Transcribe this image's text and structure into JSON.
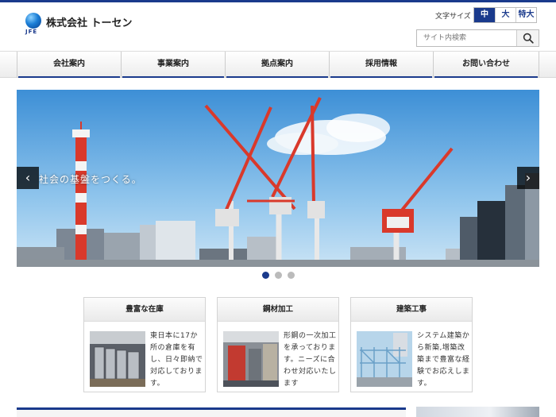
{
  "header": {
    "logo_mark": "JFE",
    "company_name": "株式会社 トーセン",
    "font_size_label": "文字サイズ",
    "font_sizes": [
      "中",
      "大",
      "特大"
    ],
    "font_size_selected": "中",
    "search_placeholder": "サイト内検索"
  },
  "nav": {
    "items": [
      "会社案内",
      "事業案内",
      "拠点案内",
      "採用情報",
      "お問い合わせ"
    ]
  },
  "slider": {
    "caption": "社会の基盤をつくる。",
    "prev_label": "‹",
    "next_label": "›",
    "slide_count": 3,
    "active_slide": 1
  },
  "cards": [
    {
      "title": "豊富な在庫",
      "text": "東日本に17か所の倉庫を有し、日々即納で対応しております。"
    },
    {
      "title": "鋼材加工",
      "text": "形鋼の一次加工を承っております。ニーズに合わせ対応いたします"
    },
    {
      "title": "建築工事",
      "text": "システム建築から新築,増築改築まで豊富な経験でお応えします。"
    }
  ],
  "colors": {
    "brand": "#1a3a8c",
    "crane": "#d9392b"
  }
}
